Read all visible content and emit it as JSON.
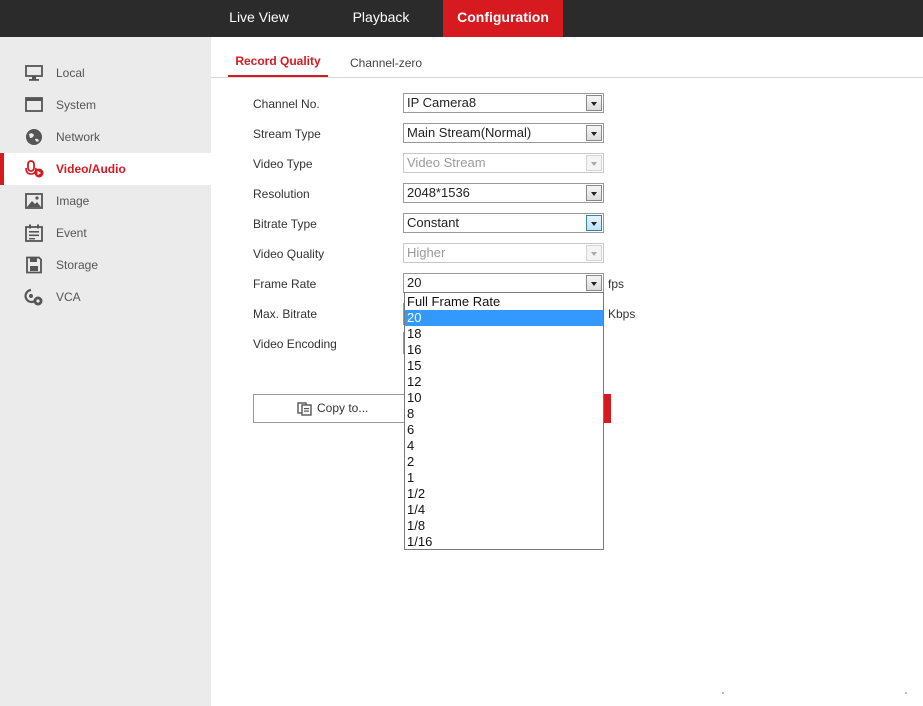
{
  "topnav": {
    "live_view": "Live View",
    "playback": "Playback",
    "configuration": "Configuration"
  },
  "sidebar": {
    "items": [
      {
        "label": "Local",
        "icon": "monitor-icon"
      },
      {
        "label": "System",
        "icon": "system-icon"
      },
      {
        "label": "Network",
        "icon": "globe-icon"
      },
      {
        "label": "Video/Audio",
        "icon": "microphone-icon",
        "active": true
      },
      {
        "label": "Image",
        "icon": "image-icon"
      },
      {
        "label": "Event",
        "icon": "calendar-icon"
      },
      {
        "label": "Storage",
        "icon": "floppy-disk-icon"
      },
      {
        "label": "VCA",
        "icon": "vca-icon"
      }
    ]
  },
  "tabs": {
    "record_quality": "Record Quality",
    "channel_zero": "Channel-zero"
  },
  "form": {
    "channel_no": {
      "label": "Channel No.",
      "value": "IP Camera8"
    },
    "stream_type": {
      "label": "Stream Type",
      "value": "Main Stream(Normal)"
    },
    "video_type": {
      "label": "Video Type",
      "value": "Video Stream"
    },
    "resolution": {
      "label": "Resolution",
      "value": "2048*1536"
    },
    "bitrate_type": {
      "label": "Bitrate Type",
      "value": "Constant"
    },
    "video_quality": {
      "label": "Video Quality",
      "value": "Higher"
    },
    "frame_rate": {
      "label": "Frame Rate",
      "value": "20",
      "unit": "fps"
    },
    "max_bitrate": {
      "label": "Max. Bitrate",
      "unit": "Kbps"
    },
    "video_encoding": {
      "label": "Video Encoding"
    }
  },
  "buttons": {
    "copy_to": "Copy to..."
  },
  "frame_rate_options": [
    "Full Frame Rate",
    "20",
    "18",
    "16",
    "15",
    "12",
    "10",
    "8",
    "6",
    "4",
    "2",
    "1",
    "1/2",
    "1/4",
    "1/8",
    "1/16"
  ],
  "frame_rate_selected": "20",
  "colors": {
    "accent": "#d71920",
    "topbar": "#2b2b2b",
    "sidebar": "#ebebeb",
    "highlight": "#3399ff"
  }
}
